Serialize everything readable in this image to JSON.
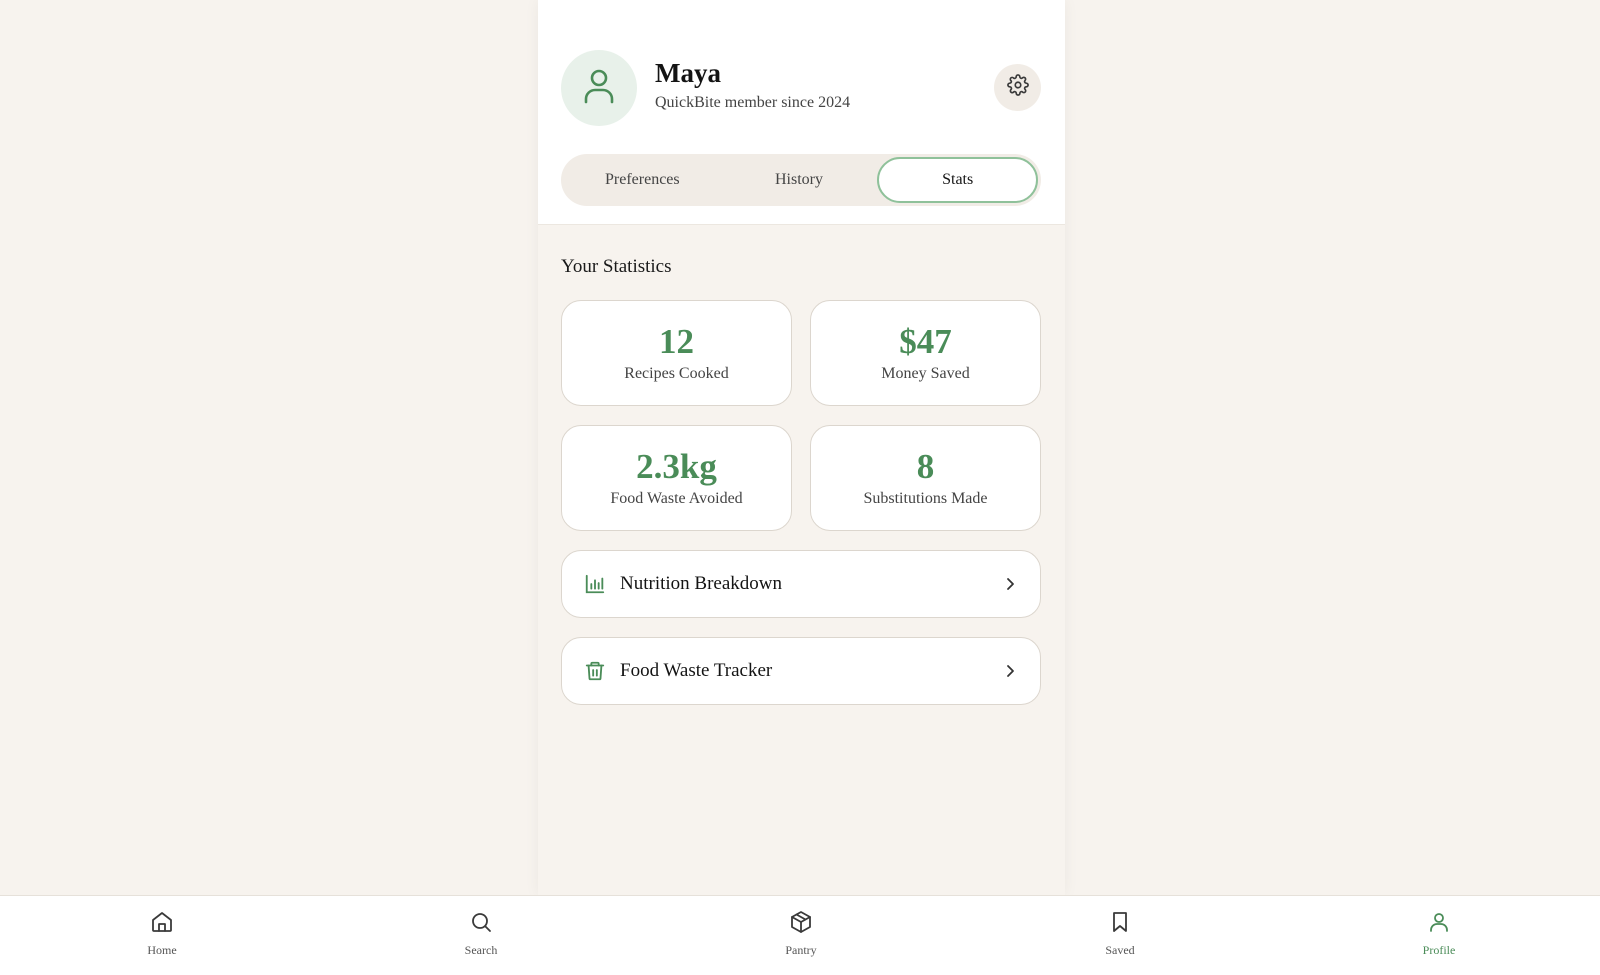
{
  "profile": {
    "name": "Maya",
    "subtitle": "QuickBite member since 2024",
    "avatar_icon": "user-icon",
    "settings_icon": "gear-icon"
  },
  "tabs": [
    {
      "label": "Preferences",
      "active": false
    },
    {
      "label": "History",
      "active": false
    },
    {
      "label": "Stats",
      "active": true
    }
  ],
  "stats": {
    "title": "Your Statistics",
    "cards": [
      {
        "value": "12",
        "label": "Recipes Cooked"
      },
      {
        "value": "$47",
        "label": "Money Saved"
      },
      {
        "value": "2.3kg",
        "label": "Food Waste Avoided"
      },
      {
        "value": "8",
        "label": "Substitutions Made"
      }
    ]
  },
  "links": [
    {
      "label": "Nutrition Breakdown",
      "icon": "bar-chart-icon"
    },
    {
      "label": "Food Waste Tracker",
      "icon": "trash-icon"
    }
  ],
  "nav": [
    {
      "label": "Home",
      "icon": "home-icon",
      "active": false
    },
    {
      "label": "Search",
      "icon": "search-icon",
      "active": false
    },
    {
      "label": "Pantry",
      "icon": "box-icon",
      "active": false
    },
    {
      "label": "Saved",
      "icon": "bookmark-icon",
      "active": false
    },
    {
      "label": "Profile",
      "icon": "user-icon",
      "active": true
    }
  ],
  "colors": {
    "accent": "#4a8c58",
    "background": "#f7f3ee",
    "active_tab_border": "#8fc19a"
  }
}
